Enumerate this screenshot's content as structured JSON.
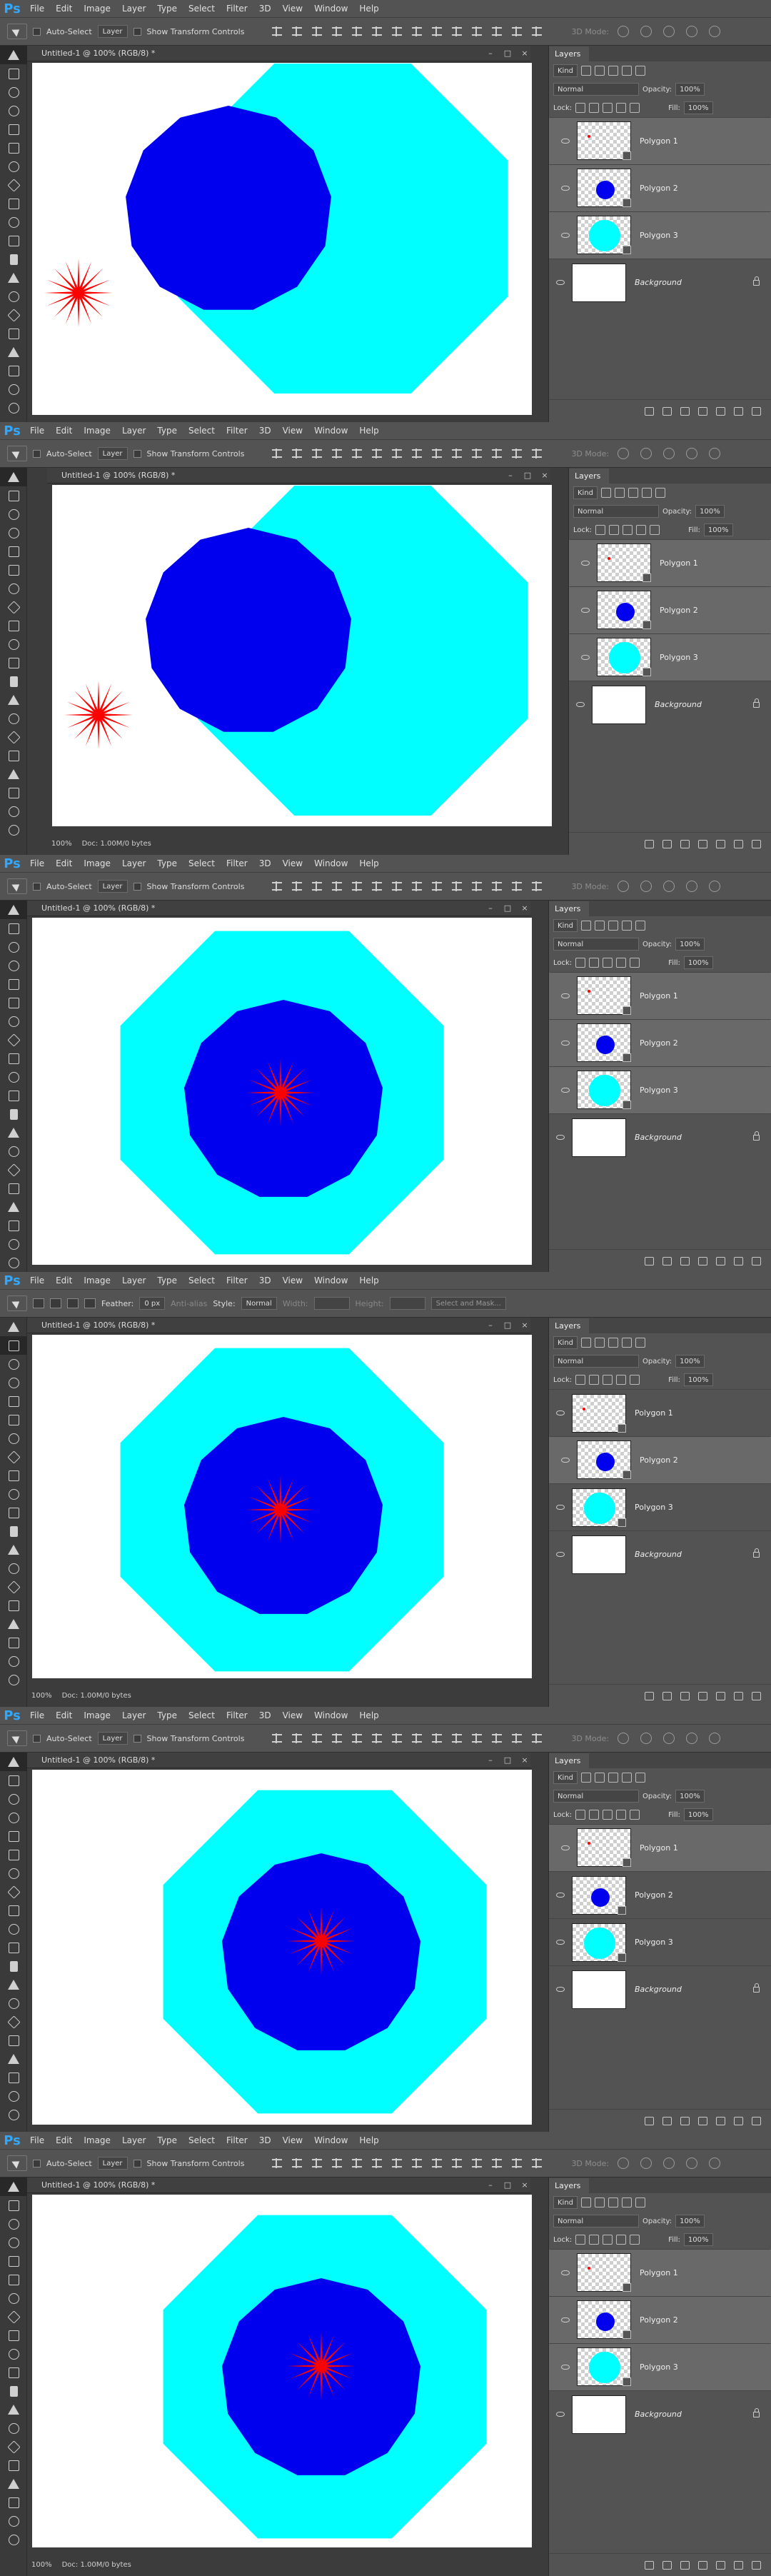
{
  "app_logo": "Ps",
  "menu": [
    "File",
    "Edit",
    "Image",
    "Layer",
    "Type",
    "Select",
    "Filter",
    "3D",
    "View",
    "Window",
    "Help"
  ],
  "move_options": {
    "auto_select": "Auto-Select",
    "layer_select": "Layer",
    "show_transform": "Show Transform Controls",
    "mode_3d": "3D Mode:"
  },
  "marquee_options": {
    "feather_label": "Feather:",
    "feather_value": "0 px",
    "anti_alias": "Anti-alias",
    "style_label": "Style:",
    "style_value": "Normal",
    "width_label": "Width:",
    "height_label": "Height:",
    "select_mask": "Select and Mask..."
  },
  "document": {
    "title": "Untitled-1 @ 100% (RGB/8) *",
    "zoom": "100%",
    "doc_info": "Doc: 1.00M/0 bytes"
  },
  "layers_panel": {
    "tab": "Layers",
    "kind_label": "Kind",
    "blend_mode": "Normal",
    "opacity_label": "Opacity:",
    "opacity_value": "100%",
    "lock_label": "Lock:",
    "fill_label": "Fill:",
    "fill_value": "100%",
    "layers": [
      {
        "name": "Polygon 1",
        "thumb": "star"
      },
      {
        "name": "Polygon 2",
        "thumb": "blue"
      },
      {
        "name": "Polygon 3",
        "thumb": "cyan"
      },
      {
        "name": "Background",
        "thumb": "white"
      }
    ]
  },
  "colors": {
    "cyan": "#00ffff",
    "blue": "#0000ee",
    "red": "#ff0000",
    "ps_blue": "#31a8ff",
    "panel": "#535353"
  },
  "screens": [
    {
      "tool": "move",
      "star_pos": "left",
      "layout": "offset",
      "show_status": false,
      "selected_layers": [
        0,
        1,
        2
      ]
    },
    {
      "tool": "move",
      "star_pos": "left",
      "layout": "offset",
      "show_status": true,
      "selected_layers": [
        0,
        1,
        2
      ]
    },
    {
      "tool": "move",
      "star_pos": "center",
      "layout": "centered",
      "show_status": false,
      "selected_layers": [
        0,
        1,
        2
      ]
    },
    {
      "tool": "marquee",
      "star_pos": "center",
      "layout": "centered",
      "show_status": true,
      "selected_layers": [
        1
      ]
    },
    {
      "tool": "move",
      "star_pos": "center",
      "layout": "centered-right",
      "show_status": false,
      "selected_layers": [
        0
      ]
    },
    {
      "tool": "move",
      "star_pos": "center",
      "layout": "centered-right",
      "show_status": true,
      "selected_layers": [
        0,
        1,
        2
      ]
    }
  ]
}
